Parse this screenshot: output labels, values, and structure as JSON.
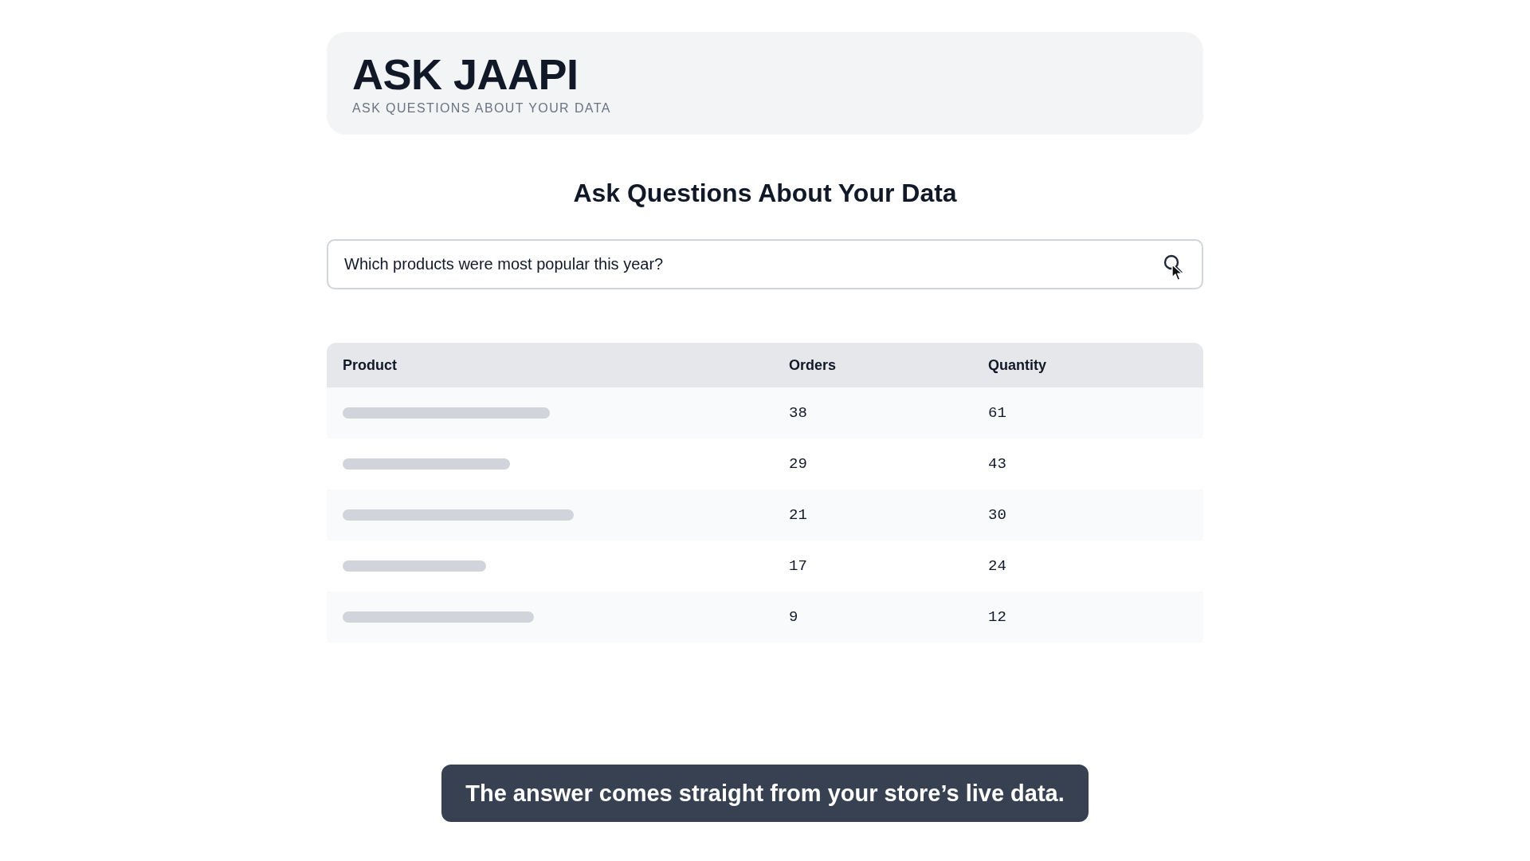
{
  "header": {
    "title": "ASK JAAPI",
    "subtitle": "ASK QUESTIONS ABOUT YOUR DATA"
  },
  "heading": "Ask Questions About Your Data",
  "search": {
    "value": "Which products were most popular this year?"
  },
  "table": {
    "columns": [
      "Product",
      "Orders",
      "Quantity"
    ],
    "rows": [
      {
        "orders": "38",
        "quantity": "61"
      },
      {
        "orders": "29",
        "quantity": "43"
      },
      {
        "orders": "21",
        "quantity": "30"
      },
      {
        "orders": "17",
        "quantity": "24"
      },
      {
        "orders": "9",
        "quantity": "12"
      }
    ]
  },
  "caption": "The answer comes straight from your store’s live data."
}
